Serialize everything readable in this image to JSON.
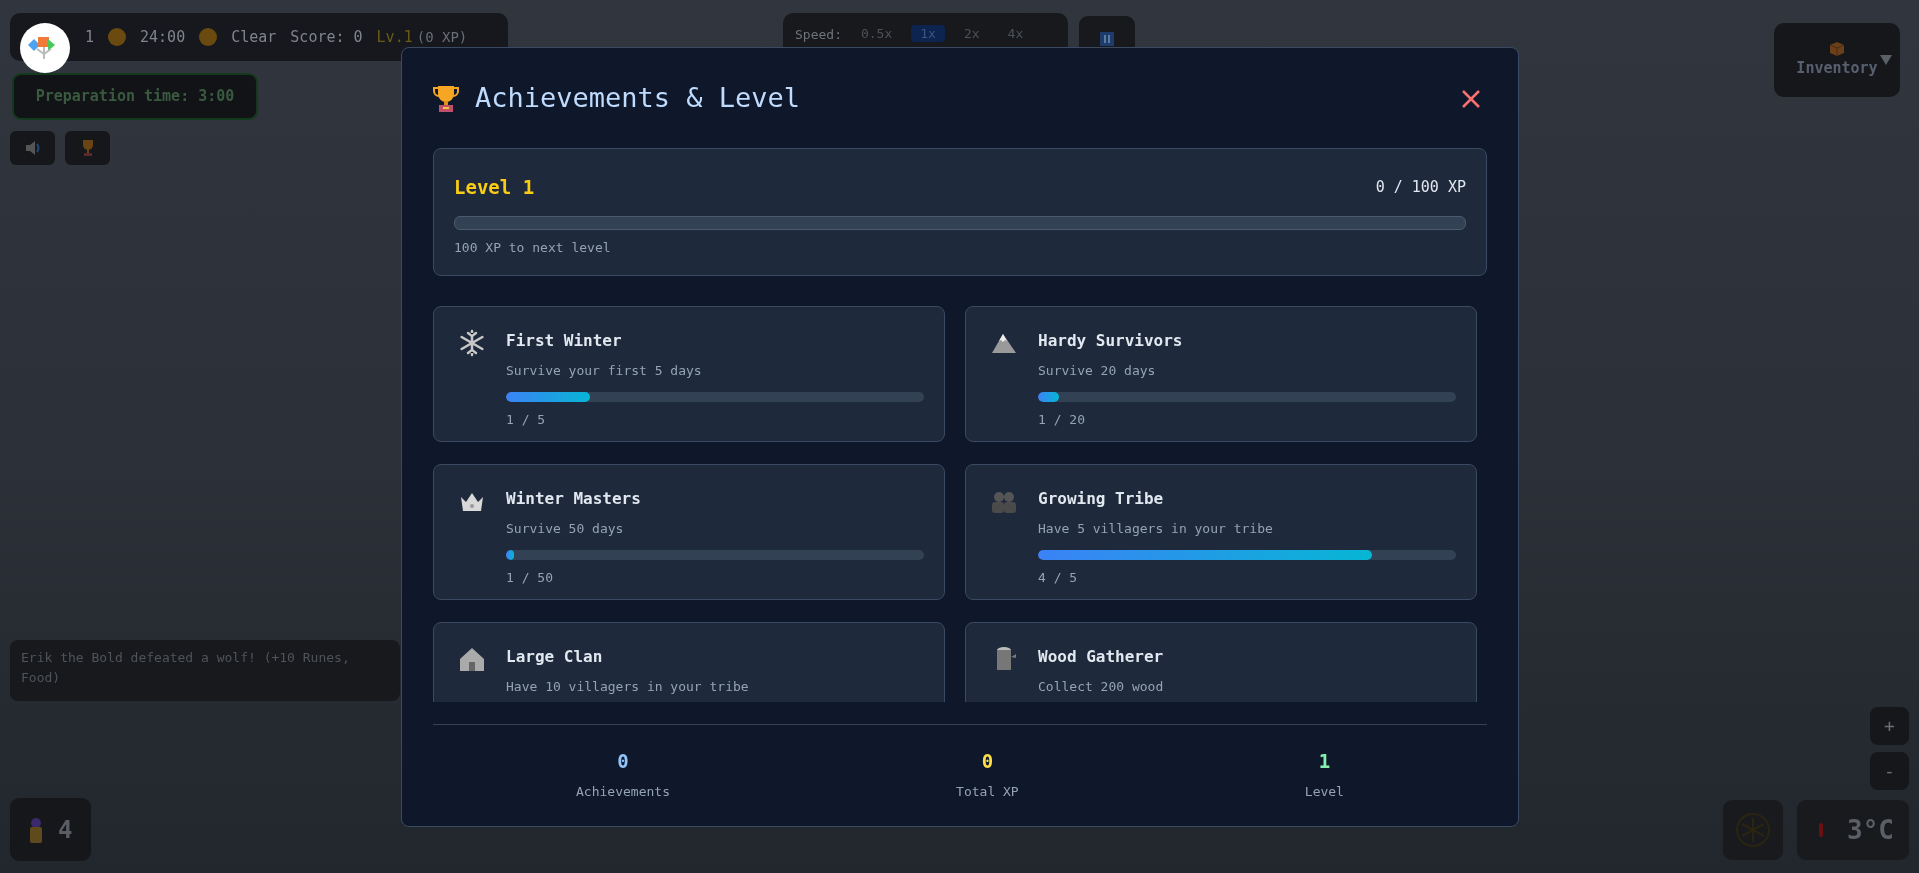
{
  "hud": {
    "day": "1",
    "time": "24:00",
    "weather": "Clear",
    "score": "Score: 0",
    "level": "Lv.1",
    "xp": "(0 XP)"
  },
  "preparation": "Preparation time: 3:00",
  "speed": {
    "label": "Speed:",
    "options": [
      {
        "label": "0.5x",
        "selected": false
      },
      {
        "label": "1x",
        "selected": true
      },
      {
        "label": "2x",
        "selected": false
      },
      {
        "label": "4x",
        "selected": false
      }
    ]
  },
  "inventory": {
    "label": "Inventory"
  },
  "event_log": [
    "Erik the Bold defeated a wolf! (+10 Runes,",
    "Food)"
  ],
  "villagers": "4",
  "zoom": [
    "+",
    "-"
  ],
  "temperature": "3°C",
  "modal": {
    "title": "Achievements & Level",
    "level_card": {
      "title": "Level 1",
      "xp": "0 / 100 XP",
      "level": 0,
      "hint": "100 XP to next level"
    },
    "achievements": [
      {
        "name": "First Winter",
        "description": "Survive your first 5 days",
        "level": 0.2,
        "progress": "1 / 5"
      },
      {
        "name": "Hardy Survivors",
        "description": "Survive 20 days",
        "level": 0.05,
        "progress": "1 / 20"
      },
      {
        "name": "Winter Masters",
        "description": "Survive 50 days",
        "level": 0.02,
        "progress": "1 / 50"
      },
      {
        "name": "Growing Tribe",
        "description": "Have 5 villagers in your tribe",
        "level": 0.8,
        "progress": "4 / 5"
      },
      {
        "name": "Large Clan",
        "description": "Have 10 villagers in your tribe"
      },
      {
        "name": "Wood Gatherer",
        "description": "Collect 200 wood"
      }
    ],
    "stats": [
      {
        "value": "0",
        "label": "Achievements",
        "color": "#93c5fd"
      },
      {
        "value": "0",
        "label": "Total XP",
        "color": "#fde047"
      },
      {
        "value": "1",
        "label": "Level",
        "color": "#86efac"
      }
    ]
  }
}
